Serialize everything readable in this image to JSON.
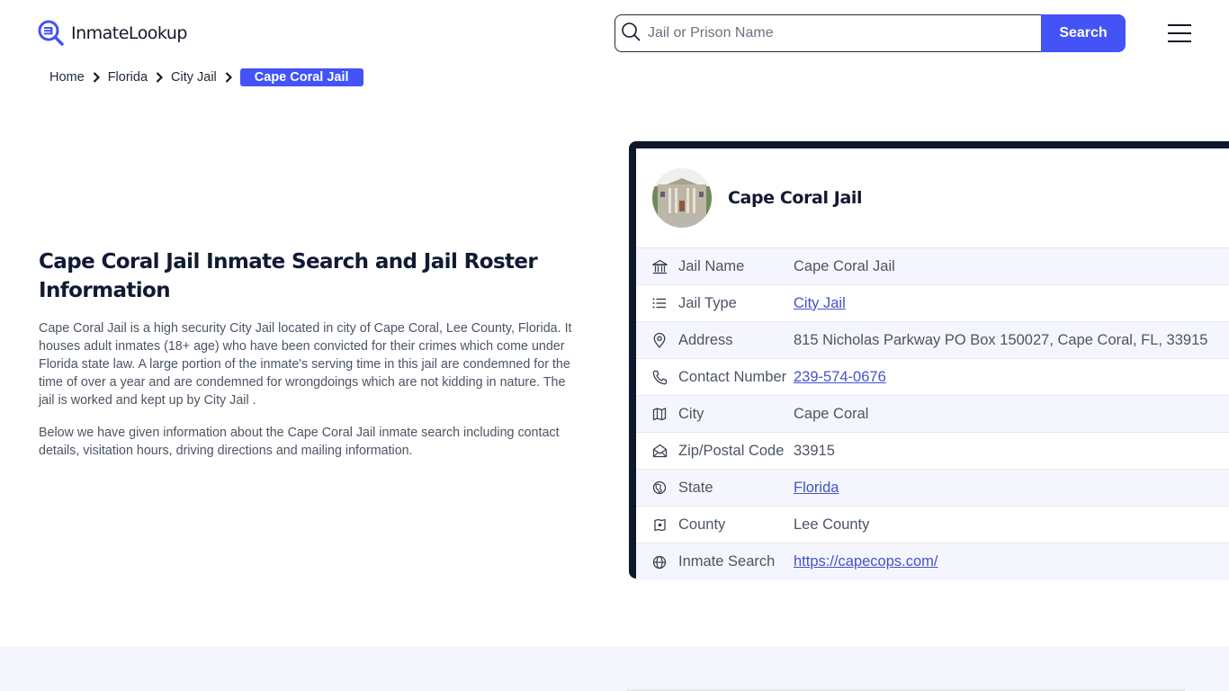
{
  "brand": {
    "name": "InmateLookup",
    "accent": "#4353f5",
    "dark": "#0f172a"
  },
  "search": {
    "placeholder": "Jail or Prison Name",
    "value": "",
    "button_label": "Search"
  },
  "breadcrumb": {
    "items": [
      {
        "label": "Home"
      },
      {
        "label": "Florida"
      },
      {
        "label": "City Jail"
      }
    ],
    "current": "Cape Coral Jail"
  },
  "hero": {
    "title": "Cape Coral Jail Inmate Search and Jail Roster Information",
    "paragraphs": [
      "Cape Coral Jail is a high security City Jail located in city of Cape Coral, Lee County, Florida. It houses adult inmates (18+ age) who have been convicted for their crimes which come under Florida state law. A large portion of the inmate's serving time in this jail are condemned for the time of over a year and are condemned for wrongdoings which are not kidding in nature. The jail is worked and kept up by City Jail .",
      "Below we have given information about the Cape Coral Jail inmate search including contact details, visitation hours, driving directions and mailing information."
    ]
  },
  "card": {
    "title": "Cape Coral Jail",
    "rows": [
      {
        "icon": "building-columns-icon",
        "label": "Jail Name",
        "value": "Cape Coral Jail",
        "link": false
      },
      {
        "icon": "list-icon",
        "label": "Jail Type",
        "value": "City Jail",
        "link": true
      },
      {
        "icon": "map-pin-icon",
        "label": "Address",
        "value": "815 Nicholas Parkway PO Box 150027, Cape Coral, FL, 33915",
        "link": false
      },
      {
        "icon": "phone-icon",
        "label": "Contact Number",
        "value": "239-574-0676",
        "link": true
      },
      {
        "icon": "map-icon",
        "label": "City",
        "value": "Cape Coral",
        "link": false
      },
      {
        "icon": "mail-open-icon",
        "label": "Zip/Postal Code",
        "value": "33915",
        "link": false
      },
      {
        "icon": "globe-pin-icon",
        "label": "State",
        "value": "Florida",
        "link": true
      },
      {
        "icon": "county-map-icon",
        "label": "County",
        "value": "Lee County",
        "link": false
      },
      {
        "icon": "globe-icon",
        "label": "Inmate Search",
        "value": "https://capecops.com/",
        "link": true
      }
    ]
  }
}
